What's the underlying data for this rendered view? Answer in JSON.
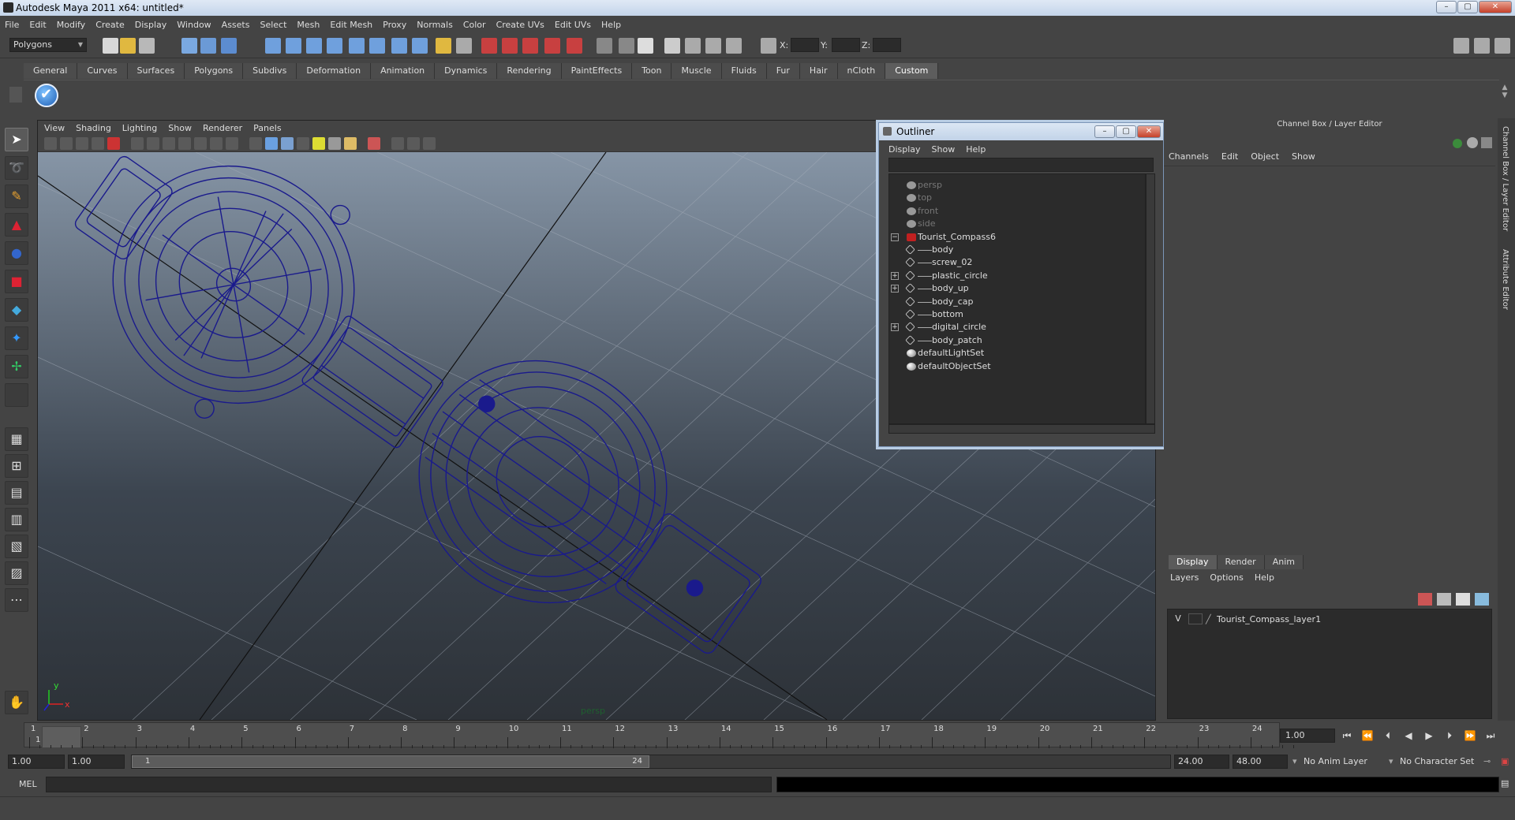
{
  "window": {
    "title": "Autodesk Maya 2011 x64: untitled*"
  },
  "menubar": [
    "File",
    "Edit",
    "Modify",
    "Create",
    "Display",
    "Window",
    "Assets",
    "Select",
    "Mesh",
    "Edit Mesh",
    "Proxy",
    "Normals",
    "Color",
    "Create UVs",
    "Edit UVs",
    "Help"
  ],
  "statusline": {
    "mode": "Polygons",
    "x_label": "X:",
    "y_label": "Y:",
    "z_label": "Z:"
  },
  "shelf": {
    "tabs": [
      "General",
      "Curves",
      "Surfaces",
      "Polygons",
      "Subdivs",
      "Deformation",
      "Animation",
      "Dynamics",
      "Rendering",
      "PaintEffects",
      "Toon",
      "Muscle",
      "Fluids",
      "Fur",
      "Hair",
      "nCloth",
      "Custom"
    ],
    "active_tab": "Custom"
  },
  "viewport": {
    "menu": [
      "View",
      "Shading",
      "Lighting",
      "Show",
      "Renderer",
      "Panels"
    ],
    "camera_label": "persp",
    "axis_x": "x",
    "axis_y": "y",
    "wire_color": "#1a1a8c"
  },
  "outliner": {
    "title": "Outliner",
    "menu": [
      "Display",
      "Show",
      "Help"
    ],
    "items": [
      {
        "label": "persp",
        "kind": "camera",
        "depth": 0,
        "expander": ""
      },
      {
        "label": "top",
        "kind": "camera",
        "depth": 0,
        "expander": ""
      },
      {
        "label": "front",
        "kind": "camera",
        "depth": 0,
        "expander": ""
      },
      {
        "label": "side",
        "kind": "camera",
        "depth": 0,
        "expander": ""
      },
      {
        "label": "Tourist_Compass6",
        "kind": "group",
        "depth": 0,
        "expander": "−"
      },
      {
        "label": "body",
        "kind": "mesh",
        "depth": 1,
        "expander": ""
      },
      {
        "label": "screw_02",
        "kind": "mesh",
        "depth": 1,
        "expander": ""
      },
      {
        "label": "plastic_circle",
        "kind": "mesh",
        "depth": 1,
        "expander": "+"
      },
      {
        "label": "body_up",
        "kind": "mesh",
        "depth": 1,
        "expander": "+"
      },
      {
        "label": "body_cap",
        "kind": "mesh",
        "depth": 1,
        "expander": ""
      },
      {
        "label": "bottom",
        "kind": "mesh",
        "depth": 1,
        "expander": ""
      },
      {
        "label": "digital_circle",
        "kind": "mesh",
        "depth": 1,
        "expander": "+"
      },
      {
        "label": "body_patch",
        "kind": "mesh",
        "depth": 1,
        "expander": ""
      },
      {
        "label": "defaultLightSet",
        "kind": "set",
        "depth": 0,
        "expander": ""
      },
      {
        "label": "defaultObjectSet",
        "kind": "set",
        "depth": 0,
        "expander": ""
      }
    ]
  },
  "channelbox": {
    "title": "Channel Box / Layer Editor",
    "menu": [
      "Channels",
      "Edit",
      "Object",
      "Show"
    ]
  },
  "layers": {
    "tabs": [
      "Display",
      "Render",
      "Anim"
    ],
    "active_tab": "Display",
    "menu": [
      "Layers",
      "Options",
      "Help"
    ],
    "rows": [
      {
        "visible": "V",
        "name": "Tourist_Compass_layer1"
      }
    ]
  },
  "side_tabs": [
    "Channel Box / Layer Editor",
    "Attribute Editor"
  ],
  "timeline": {
    "ticks": [
      "1",
      "2",
      "3",
      "4",
      "5",
      "6",
      "7",
      "8",
      "9",
      "10",
      "11",
      "12",
      "13",
      "14",
      "15",
      "16",
      "17",
      "18",
      "19",
      "20",
      "21",
      "22",
      "23",
      "24"
    ],
    "current_frame_label": "1",
    "current_time": "1.00"
  },
  "range": {
    "start_time": "1.00",
    "playback_start": "1.00",
    "slider_start": "1",
    "slider_end": "24",
    "playback_end": "24.00",
    "end_time": "48.00",
    "anim_layer": "No Anim Layer",
    "character_set": "No Character Set"
  },
  "command_line": {
    "label": "MEL"
  }
}
